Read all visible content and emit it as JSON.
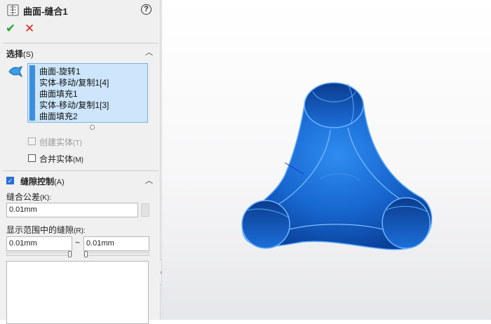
{
  "header": {
    "title": "曲面-缝合1",
    "help_glyph": "?"
  },
  "actions": {
    "ok_glyph": "✔",
    "cancel_glyph": "✕"
  },
  "selection": {
    "heading": "选择",
    "heading_key": "(S)",
    "items": [
      "曲面-旋转1",
      "实体-移动/复制1[4]",
      "曲面填充1",
      "实体-移动/复制1[3]",
      "曲面填充2"
    ],
    "create_solid": {
      "label": "创建实体",
      "key": "(T)",
      "checked": false,
      "enabled": false
    },
    "merge_entities": {
      "label": "合并实体",
      "key": "(M)",
      "checked": false,
      "enabled": true
    }
  },
  "gap_control": {
    "heading": "缝隙控制",
    "heading_key": "(A)",
    "checked": true,
    "tolerance_label": "缝合公差",
    "tolerance_key": "(K):",
    "tolerance_value": "0.01mm",
    "range_label": "显示范围中的缝隙",
    "range_key": "(R):",
    "range_min": "0.01mm",
    "range_sep": "~",
    "range_max": "0.01mm"
  },
  "colors": {
    "accent": "#2b6fd6",
    "list_bg": "#cde6fb",
    "model_blue": "#1a6fd8"
  }
}
